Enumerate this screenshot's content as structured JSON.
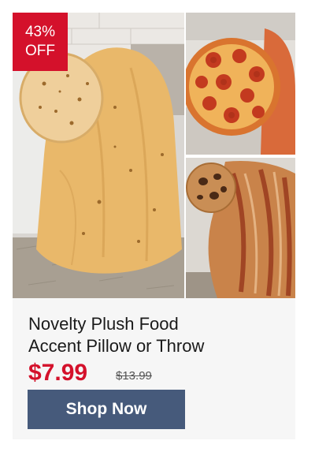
{
  "product": {
    "discount": {
      "percent": "43%",
      "label": "OFF"
    },
    "title_line1": "Novelty Plush Food",
    "title_line2": "Accent Pillow or Throw",
    "price": "$7.99",
    "original_price": "$13.99",
    "cta_label": "Shop Now"
  },
  "colors": {
    "sale_red": "#d4112b",
    "button_blue": "#465a7b"
  }
}
